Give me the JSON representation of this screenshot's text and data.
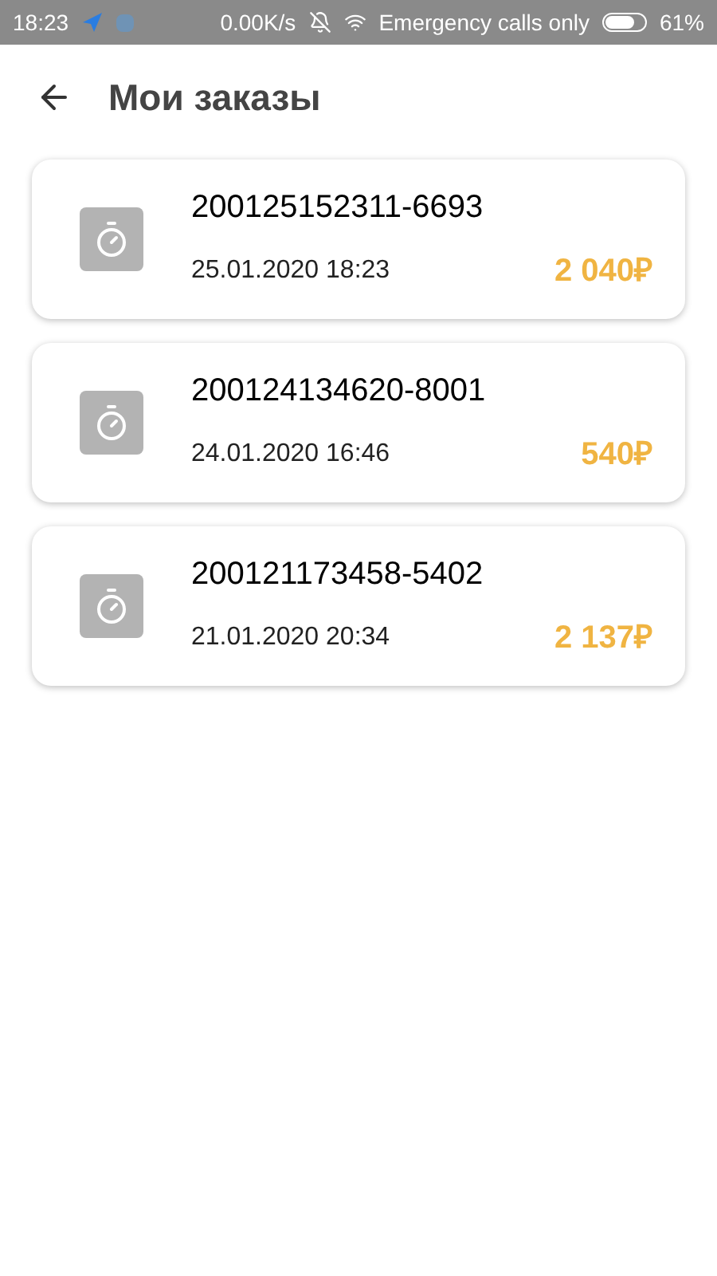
{
  "status_bar": {
    "time": "18:23",
    "speed": "0.00K/s",
    "carrier": "Emergency calls only",
    "battery": "61%"
  },
  "header": {
    "title": "Мои заказы"
  },
  "orders": [
    {
      "number": "200125152311-6693",
      "date": "25.01.2020 18:23",
      "amount": "2 040₽"
    },
    {
      "number": "200124134620-8001",
      "date": "24.01.2020 16:46",
      "amount": "540₽"
    },
    {
      "number": "200121173458-5402",
      "date": "21.01.2020 20:34",
      "amount": "2 137₽"
    }
  ]
}
